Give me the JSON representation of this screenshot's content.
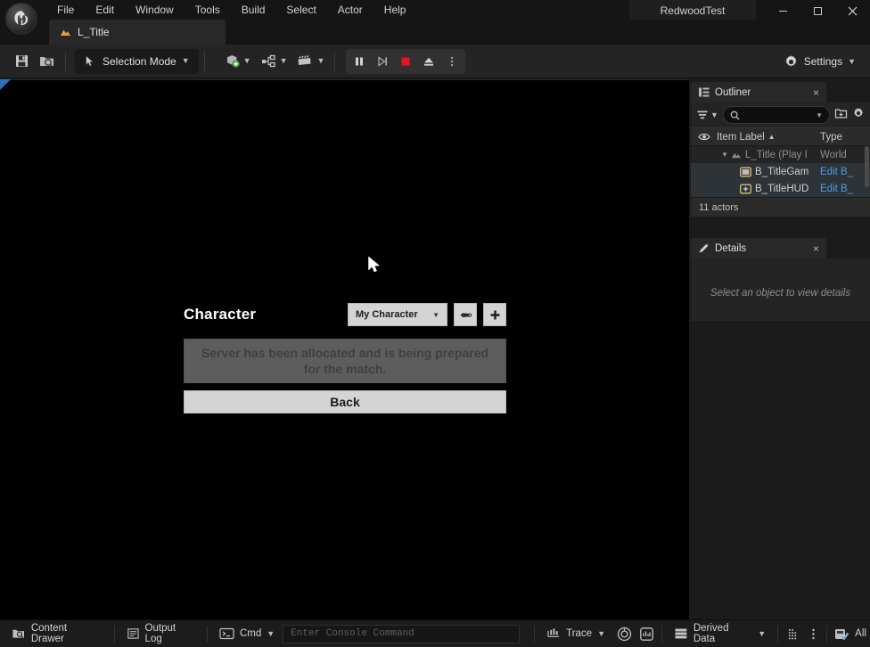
{
  "window": {
    "title": "RedwoodTest",
    "minimize_label": "Minimize",
    "maximize_label": "Maximize",
    "close_label": "Close"
  },
  "menubar": {
    "items": [
      {
        "label": "File"
      },
      {
        "label": "Edit"
      },
      {
        "label": "Window"
      },
      {
        "label": "Tools"
      },
      {
        "label": "Build"
      },
      {
        "label": "Select"
      },
      {
        "label": "Actor"
      },
      {
        "label": "Help"
      }
    ]
  },
  "level_tab": {
    "label": "L_Title",
    "icon": "level-icon"
  },
  "toolbar": {
    "save_icon": "save-icon",
    "browse_icon": "browse-content-icon",
    "mode_label": "Selection Mode",
    "create_icon": "add-actor-icon",
    "blueprints_icon": "blueprints-icon",
    "cinematics_icon": "cinematics-icon",
    "pause_label": "Pause",
    "frame_step_label": "Frame Step",
    "stop_label": "Stop",
    "eject_label": "Eject",
    "more_label": "More Play Options",
    "settings_label": "Settings"
  },
  "game_ui": {
    "character_title": "Character",
    "character_select_value": "My Character",
    "edit_button_icon": "edit-character-icon",
    "add_button_label": "+",
    "status_message": "Server has been allocated and is being prepared for the match.",
    "back_label": "Back"
  },
  "outliner": {
    "tab_title": "Outliner",
    "tab_icon": "outliner-icon",
    "close_icon": "close-icon",
    "filter_icon": "filter-icon",
    "search_icon": "search-icon",
    "search_value": "",
    "search_placeholder": "",
    "new_folder_icon": "new-folder-icon",
    "settings_icon": "gear-icon",
    "columns": {
      "visibility": "eye-icon",
      "item_label": "Item Label",
      "sort_indicator": "▲",
      "type": "Type"
    },
    "rows": [
      {
        "label": "L_Title (Play I",
        "type": "World",
        "type_is_link": false,
        "icon": "level-icon",
        "depth": 0,
        "expanded": true
      },
      {
        "label": "B_TitleGam",
        "type": "Edit B_",
        "type_is_link": true,
        "icon": "gamemode-icon",
        "depth": 1
      },
      {
        "label": "B_TitleHUD",
        "type": "Edit B_",
        "type_is_link": true,
        "icon": "hud-icon",
        "depth": 1
      }
    ],
    "status": "11 actors"
  },
  "details": {
    "tab_title": "Details",
    "tab_icon": "details-icon",
    "close_icon": "close-icon",
    "empty_message": "Select an object to view details"
  },
  "statusbar": {
    "content_drawer": "Content Drawer",
    "content_drawer_icon": "content-drawer-icon",
    "output_log": "Output Log",
    "output_log_icon": "output-log-icon",
    "cmd_label": "Cmd",
    "cmd_icon": "console-icon",
    "console_placeholder": "Enter Console Command",
    "console_value": "",
    "trace_label": "Trace",
    "trace_icon": "trace-icon",
    "trace_status_icon": "trace-status-icon",
    "trace_snapshot_icon": "trace-snapshot-icon",
    "derived_data_label": "Derived Data",
    "derived_data_icon": "derived-data-icon",
    "grid_icon": "resource-grid-icon",
    "kebab_icon": "more-options-icon",
    "source_control_label": "All",
    "source_control_icon": "source-control-icon"
  },
  "colors": {
    "accent_blue": "#4d9ee8",
    "stop_red": "#e81123",
    "level_orange": "#e6a33a",
    "pie_marker": "#2f6fb5"
  }
}
